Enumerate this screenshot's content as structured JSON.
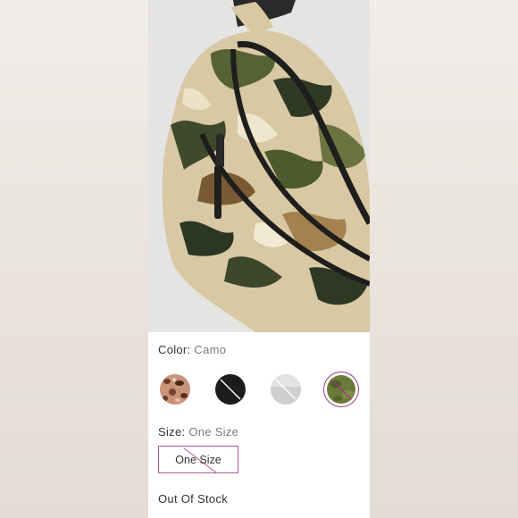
{
  "product": {
    "image_alt": "Camo quilted belt bag"
  },
  "color": {
    "label": "Color:",
    "value": "Camo",
    "swatches": [
      {
        "name": "leopard",
        "available": true,
        "selected": false
      },
      {
        "name": "black",
        "available": false,
        "selected": false
      },
      {
        "name": "silver",
        "available": false,
        "selected": false
      },
      {
        "name": "camo",
        "available": false,
        "selected": true
      }
    ]
  },
  "size": {
    "label": "Size:",
    "value": "One Size",
    "option_label": "One Size"
  },
  "stock": {
    "status": "Out Of Stock"
  },
  "colors": {
    "accent": "#9b3c7a",
    "text": "#333333",
    "muted": "#7a7a7a"
  }
}
